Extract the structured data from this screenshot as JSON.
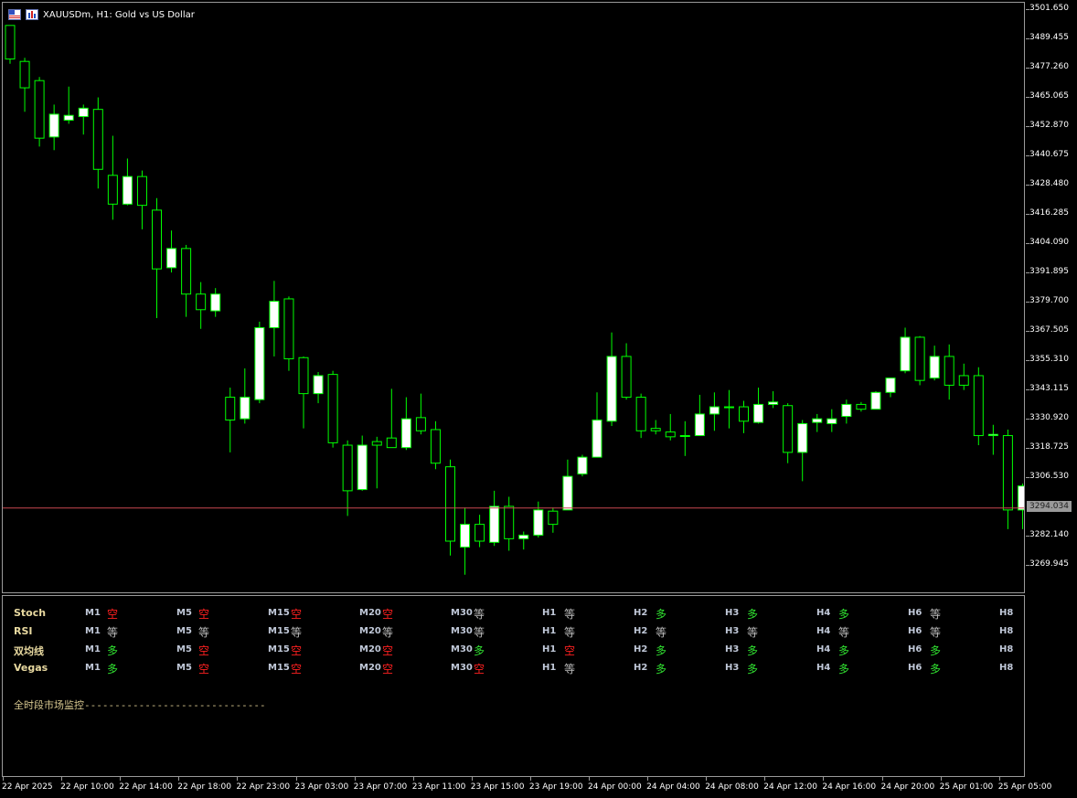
{
  "window": {
    "title": "XAUUSDm, H1:  Gold vs US Dollar"
  },
  "price_axis": {
    "labels": [
      "3501.650",
      "3489.455",
      "3477.260",
      "3465.065",
      "3452.870",
      "3440.675",
      "3428.480",
      "3416.285",
      "3404.090",
      "3391.895",
      "3379.700",
      "3367.505",
      "3355.310",
      "3343.115",
      "3330.920",
      "3318.725",
      "3306.530",
      "3282.140",
      "3269.945"
    ],
    "current_price": "3294.034"
  },
  "time_axis": {
    "labels": [
      "22 Apr 2025",
      "22 Apr 10:00",
      "22 Apr 14:00",
      "22 Apr 18:00",
      "22 Apr 23:00",
      "23 Apr 03:00",
      "23 Apr 07:00",
      "23 Apr 11:00",
      "23 Apr 15:00",
      "23 Apr 19:00",
      "24 Apr 00:00",
      "24 Apr 04:00",
      "24 Apr 08:00",
      "24 Apr 12:00",
      "24 Apr 16:00",
      "24 Apr 20:00",
      "25 Apr 01:00",
      "25 Apr 05:00"
    ]
  },
  "colors": {
    "bull_body": "#ffffff",
    "bear_body": "#000000",
    "wick": "#00ff00",
    "price_line": "#c84850",
    "sell": "#ff2020",
    "buy": "#30e030",
    "flat": "#bbbbbb"
  },
  "chart_data": {
    "type": "candlestick",
    "symbol": "XAUUSDm",
    "timeframe": "H1",
    "ylim": [
      3264,
      3502
    ],
    "candles": [
      {
        "o": 3496.0,
        "h": 3496.0,
        "l": 3480.0,
        "c": 3482.0
      },
      {
        "o": 3481.0,
        "h": 3482.5,
        "l": 3460.0,
        "c": 3470.0
      },
      {
        "o": 3473.0,
        "h": 3474.5,
        "l": 3445.5,
        "c": 3449.0
      },
      {
        "o": 3449.5,
        "h": 3463.0,
        "l": 3444.0,
        "c": 3459.0
      },
      {
        "o": 3456.5,
        "h": 3470.5,
        "l": 3455.0,
        "c": 3458.5
      },
      {
        "o": 3458.0,
        "h": 3463.0,
        "l": 3450.5,
        "c": 3461.5
      },
      {
        "o": 3461.0,
        "h": 3466.0,
        "l": 3428.0,
        "c": 3436.0
      },
      {
        "o": 3433.5,
        "h": 3450.0,
        "l": 3415.0,
        "c": 3421.5
      },
      {
        "o": 3421.5,
        "h": 3440.5,
        "l": 3421.0,
        "c": 3433.0
      },
      {
        "o": 3433.0,
        "h": 3435.5,
        "l": 3411.0,
        "c": 3421.0
      },
      {
        "o": 3419.0,
        "h": 3424.0,
        "l": 3374.0,
        "c": 3394.5
      },
      {
        "o": 3395.0,
        "h": 3410.5,
        "l": 3393.0,
        "c": 3403.0
      },
      {
        "o": 3403.0,
        "h": 3404.5,
        "l": 3374.5,
        "c": 3384.0
      },
      {
        "o": 3384.0,
        "h": 3389.0,
        "l": 3369.5,
        "c": 3377.5
      },
      {
        "o": 3377.0,
        "h": 3386.5,
        "l": 3374.5,
        "c": 3384.0
      },
      {
        "o": 3341.0,
        "h": 3345.0,
        "l": 3318.0,
        "c": 3331.5
      },
      {
        "o": 3332.0,
        "h": 3353.0,
        "l": 3330.0,
        "c": 3341.0
      },
      {
        "o": 3340.0,
        "h": 3372.5,
        "l": 3338.5,
        "c": 3370.0
      },
      {
        "o": 3370.0,
        "h": 3389.5,
        "l": 3358.0,
        "c": 3381.0
      },
      {
        "o": 3382.0,
        "h": 3383.0,
        "l": 3352.0,
        "c": 3357.0
      },
      {
        "o": 3357.5,
        "h": 3358.0,
        "l": 3328.0,
        "c": 3342.5
      },
      {
        "o": 3342.5,
        "h": 3351.5,
        "l": 3338.5,
        "c": 3350.0
      },
      {
        "o": 3350.5,
        "h": 3352.0,
        "l": 3320.0,
        "c": 3322.0
      },
      {
        "o": 3321.0,
        "h": 3323.0,
        "l": 3291.5,
        "c": 3302.0
      },
      {
        "o": 3302.5,
        "h": 3325.0,
        "l": 3302.0,
        "c": 3321.0
      },
      {
        "o": 3322.5,
        "h": 3324.5,
        "l": 3303.0,
        "c": 3321.0
      },
      {
        "o": 3324.0,
        "h": 3344.5,
        "l": 3320.0,
        "c": 3320.0
      },
      {
        "o": 3320.0,
        "h": 3341.0,
        "l": 3319.0,
        "c": 3332.0
      },
      {
        "o": 3332.5,
        "h": 3342.5,
        "l": 3325.5,
        "c": 3327.0
      },
      {
        "o": 3327.5,
        "h": 3331.0,
        "l": 3311.0,
        "c": 3313.5
      },
      {
        "o": 3312.0,
        "h": 3315.0,
        "l": 3275.0,
        "c": 3281.0
      },
      {
        "o": 3278.5,
        "h": 3295.0,
        "l": 3267.0,
        "c": 3288.0
      },
      {
        "o": 3288.0,
        "h": 3292.0,
        "l": 3278.5,
        "c": 3281.0
      },
      {
        "o": 3280.5,
        "h": 3302.0,
        "l": 3279.0,
        "c": 3295.5
      },
      {
        "o": 3295.5,
        "h": 3299.5,
        "l": 3277.0,
        "c": 3282.0
      },
      {
        "o": 3282.0,
        "h": 3285.0,
        "l": 3277.5,
        "c": 3283.5
      },
      {
        "o": 3283.5,
        "h": 3297.5,
        "l": 3282.5,
        "c": 3294.0
      },
      {
        "o": 3293.5,
        "h": 3295.0,
        "l": 3284.5,
        "c": 3288.0
      },
      {
        "o": 3294.0,
        "h": 3315.0,
        "l": 3294.0,
        "c": 3308.0
      },
      {
        "o": 3309.0,
        "h": 3317.0,
        "l": 3308.0,
        "c": 3316.0
      },
      {
        "o": 3316.0,
        "h": 3343.0,
        "l": 3316.0,
        "c": 3331.5
      },
      {
        "o": 3331.0,
        "h": 3368.0,
        "l": 3329.0,
        "c": 3358.0
      },
      {
        "o": 3358.0,
        "h": 3363.5,
        "l": 3340.0,
        "c": 3341.0
      },
      {
        "o": 3341.0,
        "h": 3342.5,
        "l": 3324.0,
        "c": 3327.0
      },
      {
        "o": 3328.0,
        "h": 3331.5,
        "l": 3325.5,
        "c": 3327.0
      },
      {
        "o": 3326.5,
        "h": 3334.0,
        "l": 3323.0,
        "c": 3324.5
      },
      {
        "o": 3325.0,
        "h": 3331.0,
        "l": 3316.5,
        "c": 3325.0
      },
      {
        "o": 3325.0,
        "h": 3342.0,
        "l": 3325.0,
        "c": 3334.0
      },
      {
        "o": 3334.0,
        "h": 3343.0,
        "l": 3327.0,
        "c": 3337.0
      },
      {
        "o": 3337.0,
        "h": 3344.0,
        "l": 3328.0,
        "c": 3337.0
      },
      {
        "o": 3337.0,
        "h": 3339.5,
        "l": 3326.0,
        "c": 3331.0
      },
      {
        "o": 3330.5,
        "h": 3345.0,
        "l": 3330.0,
        "c": 3338.0
      },
      {
        "o": 3338.0,
        "h": 3343.5,
        "l": 3336.5,
        "c": 3339.0
      },
      {
        "o": 3337.5,
        "h": 3338.5,
        "l": 3313.5,
        "c": 3318.0
      },
      {
        "o": 3318.0,
        "h": 3331.5,
        "l": 3306.0,
        "c": 3330.0
      },
      {
        "o": 3330.5,
        "h": 3334.0,
        "l": 3326.5,
        "c": 3332.0
      },
      {
        "o": 3330.0,
        "h": 3336.0,
        "l": 3326.5,
        "c": 3332.0
      },
      {
        "o": 3333.0,
        "h": 3340.0,
        "l": 3330.0,
        "c": 3338.0
      },
      {
        "o": 3338.0,
        "h": 3339.0,
        "l": 3335.0,
        "c": 3336.0
      },
      {
        "o": 3336.0,
        "h": 3343.5,
        "l": 3336.0,
        "c": 3343.0
      },
      {
        "o": 3343.0,
        "h": 3349.0,
        "l": 3341.0,
        "c": 3349.0
      },
      {
        "o": 3352.0,
        "h": 3370.0,
        "l": 3351.0,
        "c": 3366.0
      },
      {
        "o": 3366.0,
        "h": 3366.5,
        "l": 3346.0,
        "c": 3348.0
      },
      {
        "o": 3349.0,
        "h": 3362.5,
        "l": 3348.0,
        "c": 3358.0
      },
      {
        "o": 3358.0,
        "h": 3363.0,
        "l": 3340.0,
        "c": 3346.0
      },
      {
        "o": 3350.0,
        "h": 3355.0,
        "l": 3344.0,
        "c": 3346.0
      },
      {
        "o": 3350.0,
        "h": 3353.5,
        "l": 3321.0,
        "c": 3325.0
      },
      {
        "o": 3325.0,
        "h": 3329.5,
        "l": 3317.0,
        "c": 3325.5
      },
      {
        "o": 3325.0,
        "h": 3327.5,
        "l": 3286.0,
        "c": 3294.0
      },
      {
        "o": 3294.0,
        "h": 3305.0,
        "l": 3286.0,
        "c": 3304.0
      }
    ],
    "current_price": 3294.034,
    "price_ticks": [
      3501.65,
      3489.455,
      3477.26,
      3465.065,
      3452.87,
      3440.675,
      3428.48,
      3416.285,
      3404.09,
      3391.895,
      3379.7,
      3367.505,
      3355.31,
      3343.115,
      3330.92,
      3318.725,
      3306.53,
      3282.14,
      3269.945
    ]
  },
  "panel": {
    "rows": [
      {
        "name": "Stoch",
        "signals": [
          "空",
          "空",
          "空",
          "空",
          "等",
          "等",
          "多",
          "多",
          "多",
          "等",
          ""
        ]
      },
      {
        "name": "RSI",
        "signals": [
          "等",
          "等",
          "等",
          "等",
          "等",
          "等",
          "等",
          "等",
          "等",
          "等",
          ""
        ]
      },
      {
        "name": "双均线",
        "signals": [
          "多",
          "空",
          "空",
          "空",
          "多",
          "空",
          "多",
          "多",
          "多",
          "多",
          ""
        ]
      },
      {
        "name": "Vegas",
        "signals": [
          "多",
          "空",
          "空",
          "空",
          "空",
          "等",
          "多",
          "多",
          "多",
          "多",
          ""
        ]
      }
    ],
    "timeframes": [
      "M1",
      "M5",
      "M15",
      "M20",
      "M30",
      "H1",
      "H2",
      "H3",
      "H4",
      "H6",
      "H8"
    ],
    "signal_types": {
      "空": "sell",
      "多": "buy",
      "等": "flat"
    },
    "monitor_text": "全时段市场监控------------------------------"
  }
}
